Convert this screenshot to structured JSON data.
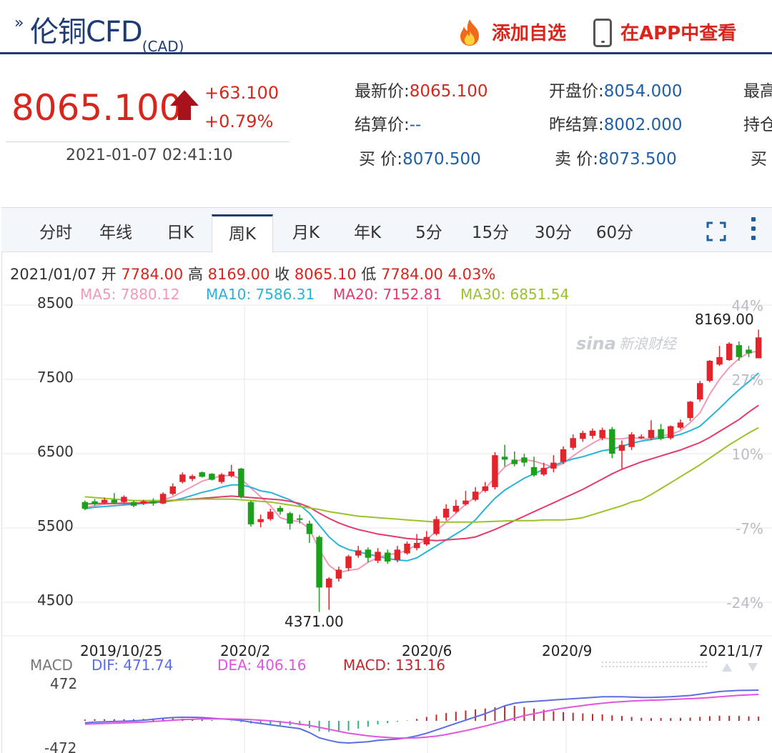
{
  "header": {
    "title": "伦铜CFD",
    "title_sub": "(CAD)",
    "add_watchlist": "添加自选",
    "view_in_app": "在APP中查看"
  },
  "quote": {
    "price": "8065.100",
    "change": "+63.100",
    "change_pct": "+0.79%",
    "timestamp": "2021-01-07 02:41:10",
    "fields": {
      "latest_label": "最新价:",
      "latest": "8065.100",
      "open_label": "开盘价:",
      "open": "8054.000",
      "high_label": "最高",
      "settle_label": "结算价:",
      "settle": "--",
      "prev_settle_label": "昨结算:",
      "prev_settle": "8002.000",
      "position_label": "持仓",
      "bid_label": "买  价:",
      "bid": "8070.500",
      "ask_label": "卖  价:",
      "ask": "8073.500",
      "buy_cut": "买"
    }
  },
  "tabs": [
    "分时",
    "年线",
    "日K",
    "周K",
    "月K",
    "年K",
    "5分",
    "15分",
    "30分",
    "60分"
  ],
  "active_tab": "周K",
  "bar_info": {
    "date": "2021/01/07",
    "open_label": "开",
    "open": "7784.00",
    "high_label": "高",
    "high": "8169.00",
    "close_label": "收",
    "close": "8065.10",
    "low_label": "低",
    "low": "7784.00",
    "pct": "4.03%"
  },
  "ma": {
    "ma5": "MA5: 7880.12",
    "ma10": "MA10: 7586.31",
    "ma20": "MA20: 7152.81",
    "ma30": "MA30: 6851.54"
  },
  "colors": {
    "up": "#e3242b",
    "down": "#1aa01a",
    "ma5": "#f29ab5",
    "ma10": "#27b4d8",
    "ma20": "#e53a6b",
    "ma30": "#9bc22b",
    "dif": "#5b6ee6",
    "dea": "#e055e0",
    "macd": "#c0282b",
    "brand": "#1f3b73"
  },
  "watermark": "新浪财经",
  "chart_data": {
    "type": "candlestick",
    "y_ticks": [
      "8500",
      "7500",
      "6500",
      "5500",
      "4500"
    ],
    "pct_ticks": [
      "44%",
      "27%",
      "10%",
      "-7%",
      "-24%"
    ],
    "x_labels": [
      "2019/10/25",
      "2020/2",
      "2020/6",
      "2020/9",
      "2021/1/7"
    ],
    "max_label": "8169.00",
    "min_label": "4371.00",
    "ylim": [
      4050,
      8500
    ],
    "candles": [
      [
        5850,
        5760,
        5870,
        5740
      ],
      [
        5860,
        5820,
        5890,
        5800
      ],
      [
        5840,
        5880,
        5910,
        5820
      ],
      [
        5880,
        5840,
        5970,
        5820
      ],
      [
        5850,
        5920,
        5940,
        5830
      ],
      [
        5850,
        5800,
        5870,
        5780
      ],
      [
        5830,
        5860,
        5880,
        5810
      ],
      [
        5860,
        5830,
        5900,
        5800
      ],
      [
        5830,
        5960,
        5980,
        5820
      ],
      [
        5960,
        6060,
        6100,
        5940
      ],
      [
        6120,
        6220,
        6250,
        6100
      ],
      [
        6160,
        6200,
        6220,
        6130
      ],
      [
        6250,
        6190,
        6260,
        6180
      ],
      [
        6230,
        6150,
        6240,
        6140
      ],
      [
        6120,
        6220,
        6240,
        6100
      ],
      [
        6200,
        6260,
        6350,
        6180
      ],
      [
        6300,
        5920,
        6310,
        5900
      ],
      [
        5850,
        5550,
        5870,
        5520
      ],
      [
        5580,
        5620,
        5680,
        5510
      ],
      [
        5620,
        5720,
        5760,
        5600
      ],
      [
        5770,
        5720,
        5800,
        5680
      ],
      [
        5700,
        5560,
        5720,
        5480
      ],
      [
        5630,
        5610,
        5680,
        5560
      ],
      [
        5560,
        5420,
        5600,
        5300
      ],
      [
        5380,
        4700,
        5400,
        4371
      ],
      [
        4700,
        4820,
        4840,
        4400
      ],
      [
        4820,
        4940,
        4980,
        4780
      ],
      [
        4960,
        5120,
        5140,
        4920
      ],
      [
        5130,
        5200,
        5260,
        5100
      ],
      [
        5210,
        5100,
        5240,
        5040
      ],
      [
        5060,
        5180,
        5230,
        5030
      ],
      [
        5170,
        5050,
        5210,
        5020
      ],
      [
        5070,
        5210,
        5260,
        5040
      ],
      [
        5160,
        5290,
        5320,
        5140
      ],
      [
        5230,
        5300,
        5420,
        5200
      ],
      [
        5280,
        5380,
        5460,
        5260
      ],
      [
        5420,
        5620,
        5660,
        5400
      ],
      [
        5640,
        5760,
        5820,
        5600
      ],
      [
        5720,
        5800,
        5880,
        5700
      ],
      [
        5820,
        5870,
        6000,
        5800
      ],
      [
        5880,
        5990,
        6050,
        5860
      ],
      [
        6000,
        6060,
        6120,
        5980
      ],
      [
        6050,
        6480,
        6520,
        6020
      ],
      [
        6460,
        6420,
        6620,
        6330
      ],
      [
        6420,
        6360,
        6530,
        6330
      ],
      [
        6450,
        6380,
        6500,
        6330
      ],
      [
        6320,
        6210,
        6460,
        6190
      ],
      [
        6220,
        6310,
        6380,
        6200
      ],
      [
        6300,
        6380,
        6480,
        6250
      ],
      [
        6390,
        6560,
        6600,
        6360
      ],
      [
        6580,
        6710,
        6760,
        6550
      ],
      [
        6700,
        6780,
        6810,
        6660
      ],
      [
        6740,
        6810,
        6840,
        6700
      ],
      [
        6710,
        6820,
        6850,
        6680
      ],
      [
        6830,
        6500,
        6860,
        6440
      ],
      [
        6540,
        6620,
        6680,
        6300
      ],
      [
        6590,
        6760,
        6790,
        6550
      ],
      [
        6720,
        6730,
        6760,
        6700
      ],
      [
        6710,
        6820,
        6950,
        6680
      ],
      [
        6830,
        6700,
        6900,
        6680
      ],
      [
        6710,
        6870,
        6880,
        6690
      ],
      [
        6850,
        6920,
        6960,
        6830
      ],
      [
        6980,
        7200,
        7210,
        6940
      ],
      [
        7230,
        7450,
        7480,
        7200
      ],
      [
        7480,
        7750,
        7760,
        7460
      ],
      [
        7700,
        7800,
        7950,
        7680
      ],
      [
        7760,
        7980,
        8000,
        7750
      ],
      [
        7960,
        7800,
        8010,
        7750
      ],
      [
        7900,
        7850,
        7950,
        7800
      ],
      [
        7784,
        8065,
        8169,
        7784
      ]
    ],
    "ma_series": [
      {
        "name": "MA5",
        "values": [
          5780,
          5800,
          5820,
          5830,
          5840,
          5840,
          5845,
          5855,
          5880,
          5920,
          5990,
          6060,
          6130,
          6170,
          6200,
          6210,
          6160,
          6040,
          5920,
          5800,
          5640,
          5600,
          5590,
          5490,
          5210,
          5000,
          4900,
          4930,
          4950,
          5040,
          5100,
          5140,
          5160,
          5200,
          5280,
          5340,
          5460,
          5580,
          5700,
          5820,
          5920,
          6030,
          6180,
          6320,
          6400,
          6420,
          6400,
          6360,
          6320,
          6370,
          6470,
          6560,
          6640,
          6710,
          6700,
          6700,
          6720,
          6700,
          6700,
          6740,
          6760,
          6810,
          6920,
          7050,
          7300,
          7500,
          7660,
          7780,
          7860,
          7880
        ]
      },
      {
        "name": "MA10",
        "values": [
          5760,
          5780,
          5790,
          5800,
          5810,
          5820,
          5830,
          5840,
          5850,
          5870,
          5900,
          5940,
          5980,
          6010,
          6050,
          6080,
          6080,
          6050,
          6000,
          5980,
          5930,
          5880,
          5810,
          5700,
          5540,
          5380,
          5270,
          5210,
          5180,
          5150,
          5120,
          5090,
          5070,
          5060,
          5100,
          5180,
          5260,
          5340,
          5420,
          5500,
          5610,
          5760,
          5900,
          6010,
          6090,
          6170,
          6230,
          6290,
          6340,
          6390,
          6430,
          6460,
          6500,
          6540,
          6560,
          6600,
          6640,
          6670,
          6690,
          6710,
          6730,
          6760,
          6810,
          6870,
          6990,
          7110,
          7240,
          7360,
          7470,
          7586
        ]
      },
      {
        "name": "MA20",
        "values": [
          5820,
          5830,
          5830,
          5830,
          5830,
          5830,
          5840,
          5850,
          5860,
          5870,
          5880,
          5890,
          5900,
          5910,
          5920,
          5930,
          5920,
          5910,
          5900,
          5890,
          5880,
          5860,
          5830,
          5780,
          5700,
          5630,
          5570,
          5520,
          5480,
          5450,
          5420,
          5400,
          5380,
          5360,
          5350,
          5340,
          5330,
          5340,
          5350,
          5360,
          5380,
          5430,
          5480,
          5540,
          5600,
          5660,
          5720,
          5780,
          5840,
          5900,
          5960,
          6020,
          6090,
          6160,
          6230,
          6290,
          6340,
          6390,
          6430,
          6470,
          6510,
          6550,
          6600,
          6650,
          6720,
          6800,
          6880,
          6960,
          7060,
          7152
        ]
      },
      {
        "name": "MA30",
        "values": [
          5920,
          5910,
          5900,
          5890,
          5880,
          5870,
          5870,
          5870,
          5870,
          5875,
          5880,
          5885,
          5890,
          5890,
          5890,
          5890,
          5880,
          5870,
          5860,
          5850,
          5830,
          5810,
          5790,
          5770,
          5750,
          5720,
          5700,
          5680,
          5660,
          5650,
          5640,
          5630,
          5620,
          5610,
          5600,
          5590,
          5580,
          5580,
          5580,
          5580,
          5580,
          5585,
          5590,
          5595,
          5600,
          5600,
          5600,
          5610,
          5610,
          5610,
          5620,
          5640,
          5680,
          5720,
          5760,
          5800,
          5850,
          5880,
          5950,
          6030,
          6110,
          6190,
          6270,
          6350,
          6440,
          6530,
          6620,
          6700,
          6780,
          6851
        ]
      }
    ],
    "macd": {
      "label": "MACD",
      "dif_label": "DIF: 471.74",
      "dea_label": "DEA: 406.16",
      "macd_label": "MACD: 131.16",
      "y_ticks": [
        "472",
        "-472"
      ],
      "ylim": [
        -472,
        472
      ],
      "dif": [
        -30,
        -20,
        -15,
        -10,
        -5,
        0,
        10,
        25,
        40,
        50,
        55,
        55,
        50,
        40,
        30,
        20,
        5,
        -20,
        -40,
        -60,
        -80,
        -100,
        -120,
        -180,
        -260,
        -300,
        -330,
        -340,
        -330,
        -320,
        -300,
        -290,
        -280,
        -260,
        -230,
        -190,
        -140,
        -90,
        -40,
        10,
        60,
        110,
        170,
        230,
        270,
        290,
        300,
        310,
        320,
        330,
        340,
        350,
        360,
        370,
        370,
        370,
        365,
        360,
        360,
        365,
        370,
        380,
        390,
        410,
        430,
        450,
        460,
        468,
        470,
        472
      ],
      "dea": [
        -50,
        -45,
        -40,
        -35,
        -30,
        -25,
        -20,
        -10,
        0,
        10,
        20,
        25,
        30,
        30,
        30,
        28,
        25,
        20,
        10,
        0,
        -15,
        -30,
        -50,
        -70,
        -100,
        -130,
        -160,
        -190,
        -210,
        -230,
        -245,
        -255,
        -265,
        -265,
        -260,
        -250,
        -235,
        -210,
        -180,
        -150,
        -115,
        -80,
        -40,
        0,
        40,
        80,
        110,
        140,
        170,
        195,
        215,
        235,
        255,
        270,
        285,
        295,
        305,
        312,
        318,
        322,
        328,
        335,
        340,
        348,
        358,
        370,
        382,
        392,
        400,
        406
      ],
      "hist": [
        20,
        25,
        25,
        25,
        25,
        25,
        30,
        35,
        40,
        40,
        35,
        30,
        20,
        10,
        0,
        -8,
        -20,
        -40,
        -50,
        -60,
        -65,
        -70,
        -70,
        -110,
        -160,
        -170,
        -170,
        -150,
        -120,
        -90,
        -55,
        -35,
        -15,
        5,
        30,
        60,
        95,
        120,
        140,
        160,
        175,
        190,
        210,
        230,
        230,
        210,
        190,
        170,
        150,
        135,
        125,
        115,
        105,
        100,
        85,
        75,
        60,
        48,
        42,
        43,
        42,
        45,
        50,
        62,
        72,
        80,
        78,
        76,
        70,
        66
      ]
    }
  }
}
